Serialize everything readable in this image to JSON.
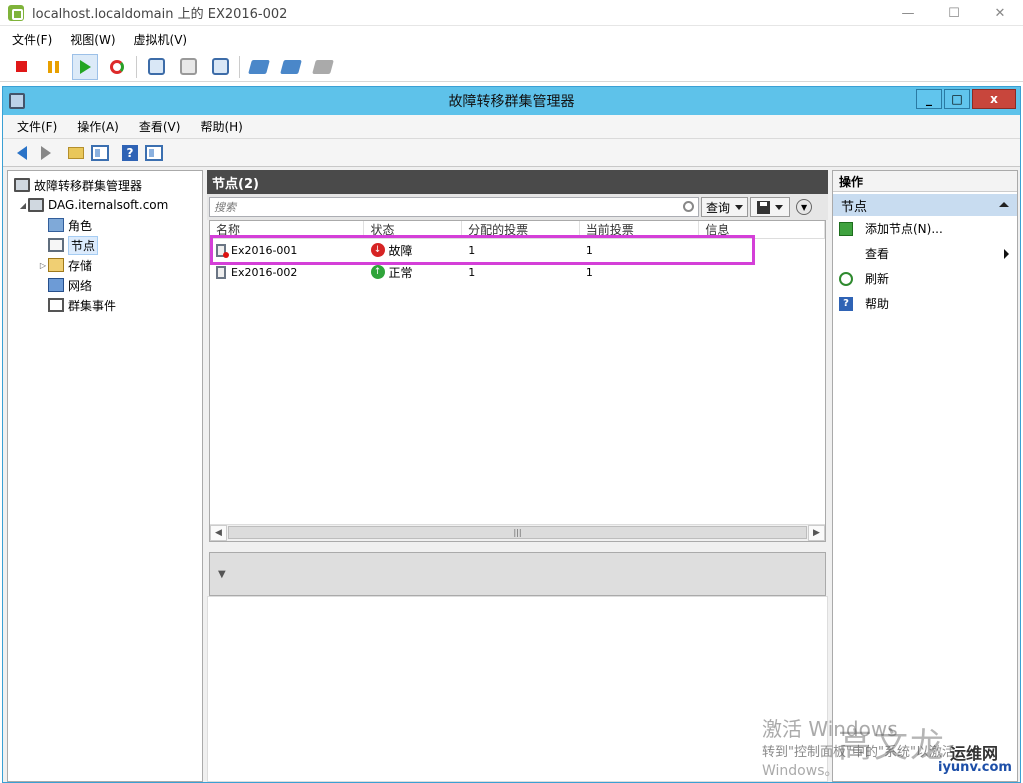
{
  "vm_window": {
    "title": "localhost.localdomain 上的 EX2016-002",
    "menu": [
      "文件(F)",
      "视图(W)",
      "虚拟机(V)"
    ],
    "controls": {
      "minimize": "—",
      "maximize": "☐",
      "close": "✕"
    }
  },
  "mmc_window": {
    "title": "故障转移群集管理器",
    "menu": [
      "文件(F)",
      "操作(A)",
      "查看(V)",
      "帮助(H)"
    ],
    "controls": {
      "minimize": "_",
      "maximize": "□",
      "close": "x"
    }
  },
  "tree": {
    "root": "故障转移群集管理器",
    "cluster": "DAG.iternalsoft.com",
    "items": [
      "角色",
      "节点",
      "存储",
      "网络",
      "群集事件"
    ],
    "selected": "节点"
  },
  "center": {
    "header": "节点(2)",
    "search_placeholder": "搜索",
    "query_label": "查询",
    "columns": [
      "名称",
      "状态",
      "分配的投票",
      "当前投票",
      "信息"
    ],
    "rows": [
      {
        "name": "Ex2016-001",
        "status": "故障",
        "status_type": "down",
        "assigned_votes": "1",
        "current_votes": "1",
        "info": ""
      },
      {
        "name": "Ex2016-002",
        "status": "正常",
        "status_type": "up",
        "assigned_votes": "1",
        "current_votes": "1",
        "info": ""
      }
    ]
  },
  "actions": {
    "header": "操作",
    "section": "节点",
    "items": [
      {
        "label": "添加节点(N)...",
        "icon": "add-node-icon",
        "submenu": false
      },
      {
        "label": "查看",
        "icon": "",
        "submenu": true
      },
      {
        "label": "刷新",
        "icon": "refresh-icon",
        "submenu": false
      },
      {
        "label": "帮助",
        "icon": "help-icon",
        "submenu": false
      }
    ]
  },
  "watermark": {
    "activate": "激活 Windows",
    "hint": "转到\"控制面板\"中的\"系统\"以激活",
    "windows": "Windows。",
    "logo": "高文龙",
    "site": "运维网",
    "url": "iyunv.com"
  },
  "colors": {
    "mmc_title": "#5ec2ea",
    "highlight": "#d43fd8",
    "section": "#c8dcf0"
  }
}
